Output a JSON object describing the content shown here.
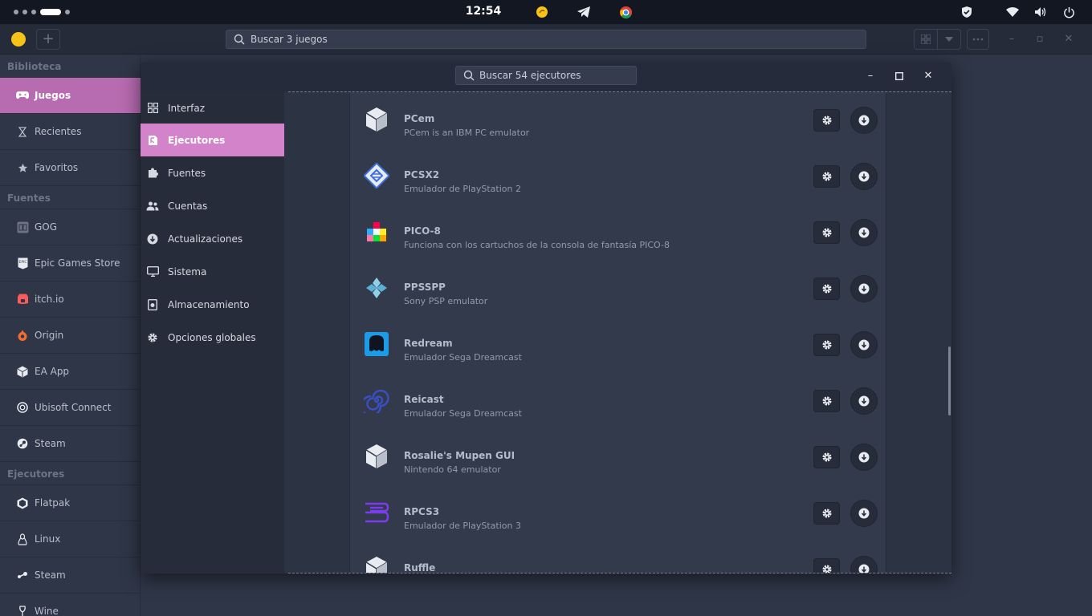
{
  "system": {
    "clock": "12:54"
  },
  "mainwindow": {
    "search_placeholder": "Buscar 3 juegos",
    "add_label": "+"
  },
  "sidebar": {
    "headers": [
      "Biblioteca",
      "Fuentes",
      "Ejecutores"
    ],
    "library": [
      {
        "label": "Juegos",
        "icon": "gamepad-icon",
        "active": true
      },
      {
        "label": "Recientes",
        "icon": "hourglass-icon"
      },
      {
        "label": "Favoritos",
        "icon": "star-icon"
      }
    ],
    "sources": [
      {
        "label": "GOG",
        "icon": "gog-icon"
      },
      {
        "label": "Epic Games Store",
        "icon": "epic-icon"
      },
      {
        "label": "itch.io",
        "icon": "itch-icon"
      },
      {
        "label": "Origin",
        "icon": "origin-icon"
      },
      {
        "label": "EA App",
        "icon": "ea-icon"
      },
      {
        "label": "Ubisoft Connect",
        "icon": "ubisoft-icon"
      },
      {
        "label": "Steam",
        "icon": "steam-icon"
      }
    ],
    "runners": [
      {
        "label": "Flatpak",
        "icon": "flatpak-icon"
      },
      {
        "label": "Linux",
        "icon": "linux-icon"
      },
      {
        "label": "Steam",
        "icon": "steam-icon"
      },
      {
        "label": "Wine",
        "icon": "wine-icon"
      }
    ]
  },
  "dialog": {
    "search_placeholder": "Buscar 54 ejecutores",
    "nav": [
      {
        "label": "Interfaz",
        "icon": "grid-icon"
      },
      {
        "label": "Ejecutores",
        "icon": "runner-icon",
        "active": true
      },
      {
        "label": "Fuentes",
        "icon": "puzzle-icon"
      },
      {
        "label": "Cuentas",
        "icon": "users-icon"
      },
      {
        "label": "Actualizaciones",
        "icon": "download-circle-icon"
      },
      {
        "label": "Sistema",
        "icon": "monitor-icon"
      },
      {
        "label": "Almacenamiento",
        "icon": "storage-icon"
      },
      {
        "label": "Opciones globales",
        "icon": "gear-icon"
      }
    ],
    "runners": [
      {
        "name": "PCem",
        "desc": "PCem is an IBM PC emulator",
        "icon": "cube-icon"
      },
      {
        "name": "PCSX2",
        "desc": "Emulador de PlayStation 2",
        "icon": "pcsx2-icon"
      },
      {
        "name": "PICO-8",
        "desc": "Funciona con los cartuchos de la consola de fantasía PICO-8",
        "icon": "pico8-icon"
      },
      {
        "name": "PPSSPP",
        "desc": "Sony PSP emulator",
        "icon": "ppsspp-icon"
      },
      {
        "name": "Redream",
        "desc": "Emulador Sega Dreamcast",
        "icon": "redream-icon"
      },
      {
        "name": "Reicast",
        "desc": "Emulador Sega Dreamcast",
        "icon": "reicast-icon"
      },
      {
        "name": "Rosalie's Mupen GUI",
        "desc": "Nintendo 64 emulator",
        "icon": "cube-icon"
      },
      {
        "name": "RPCS3",
        "desc": "Emulador de PlayStation 3",
        "icon": "rpcs3-icon"
      },
      {
        "name": "Ruffle",
        "desc": "",
        "icon": "cube-icon"
      }
    ]
  },
  "colors": {
    "accent_main": "#b76bb0",
    "accent_dialog": "#d283c9"
  }
}
